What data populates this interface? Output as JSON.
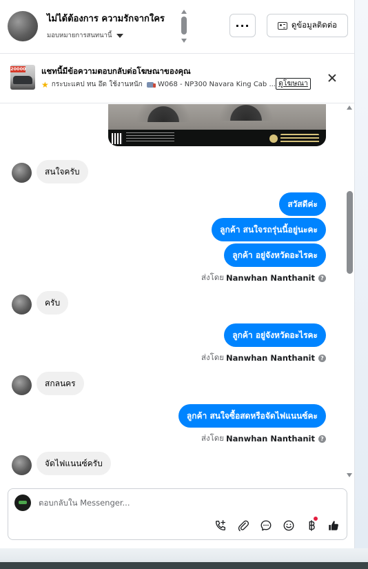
{
  "header": {
    "name": "ไม่ได้ต้องการ ความรักจากใคร",
    "assign_label": "มอบหมายการสนทนานี้",
    "more_label": "···",
    "contact_label": "ดูข้อมูลติดต่อ"
  },
  "ad": {
    "price_tag": "20000",
    "title": "แชทนี้มีข้อความตอบกลับต่อโฆษณาของคุณ",
    "line_part1": "กระบะแคป ทน อึด ใช้งานหนัก",
    "line_part2": "W068 - NP300 Navara King Cab ...",
    "link_label": "ดูโฆษณา"
  },
  "messages": [
    {
      "type": "in",
      "text": "สนใจครับ"
    },
    {
      "type": "out",
      "text": "สวัสดีค่ะ"
    },
    {
      "type": "out",
      "text": "ลูกค้า สนใจรถรุ่นนี้อยู่นะคะ"
    },
    {
      "type": "out",
      "text": "ลูกค้า อยู่จังหวัดอะไรคะ"
    },
    {
      "type": "in",
      "text": "ครับ"
    },
    {
      "type": "out",
      "text": "ลูกค้า อยู่จังหวัดอะไรคะ"
    },
    {
      "type": "in",
      "text": "สกลนคร"
    },
    {
      "type": "out",
      "text": "ลูกค้า สนใจซื้อสดหรือจัดไฟแนนซ์คะ"
    },
    {
      "type": "in",
      "text": "จัดไฟแนนซ์ครับ"
    }
  ],
  "sent_by": {
    "prefix": "ส่งโดย",
    "sender": "Nanwhan Nanthanit",
    "help": "?"
  },
  "composer": {
    "placeholder": "ตอบกลับใน Messenger..."
  },
  "icons": {
    "call": "phone-plus-icon",
    "attach": "paperclip-icon",
    "saved_reply": "chat-bubble-icon",
    "emoji": "smiley-icon",
    "payment": "baht-icon",
    "like": "thumbs-up-icon"
  },
  "colors": {
    "accent": "#0084ff",
    "incoming_bubble": "#f0f0f0",
    "like": "#1c1e21",
    "notify": "#e41e3f"
  }
}
